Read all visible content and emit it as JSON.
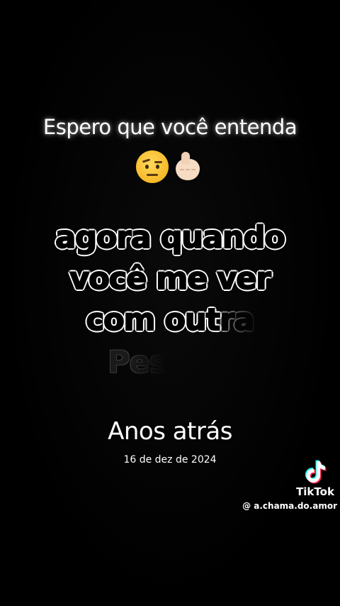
{
  "caption": {
    "top_text": "Espero que você entenda",
    "emojis": [
      "face-with-raised-eyebrow-icon",
      "pointing-hand-icon"
    ]
  },
  "lyrics": {
    "line1": "agora quando",
    "line2": "você me ver",
    "line3_main": "com out",
    "line3_fading": "ra",
    "line4_fading": "Pes"
  },
  "memory": {
    "title": "Anos atrás",
    "date": "16 de dez de 2024"
  },
  "watermark": {
    "brand": "TikTok",
    "handle": "@ a.chama.do.amor"
  },
  "colors": {
    "background": "#000000",
    "text": "#ffffff",
    "tiktok_cyan": "#25f4ee",
    "tiktok_red": "#fe2c55"
  }
}
